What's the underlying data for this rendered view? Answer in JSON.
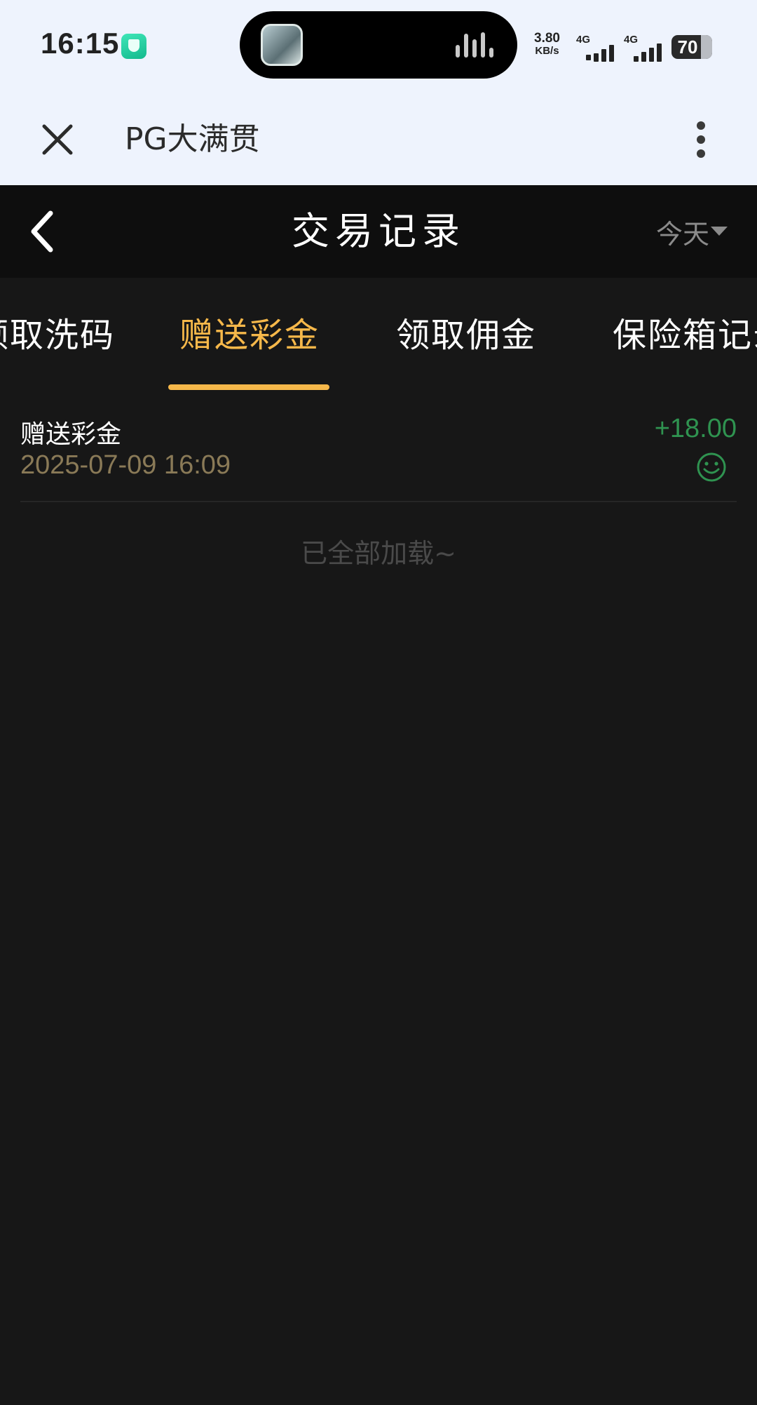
{
  "status_bar": {
    "time": "16:15",
    "net_speed_value": "3.80",
    "net_speed_unit": "KB/s",
    "sim1_type": "4G",
    "sim2_type": "4G",
    "battery": "70"
  },
  "browser": {
    "title": "PG大满贯"
  },
  "header": {
    "title": "交易记录",
    "date_filter": "今天"
  },
  "tabs": [
    {
      "label": "领取洗码",
      "active": false
    },
    {
      "label": "赠送彩金",
      "active": true
    },
    {
      "label": "领取佣金",
      "active": false
    },
    {
      "label": "保险箱记录",
      "active": false
    }
  ],
  "records": [
    {
      "type": "赠送彩金",
      "time": "2025-07-09 16:09",
      "amount": "+18.00",
      "status_icon": "smile-icon"
    }
  ],
  "load_end_text": "已全部加载~",
  "colors": {
    "accent": "#f6b84a",
    "positive": "#2f9350",
    "date_text": "#8a7a57"
  }
}
